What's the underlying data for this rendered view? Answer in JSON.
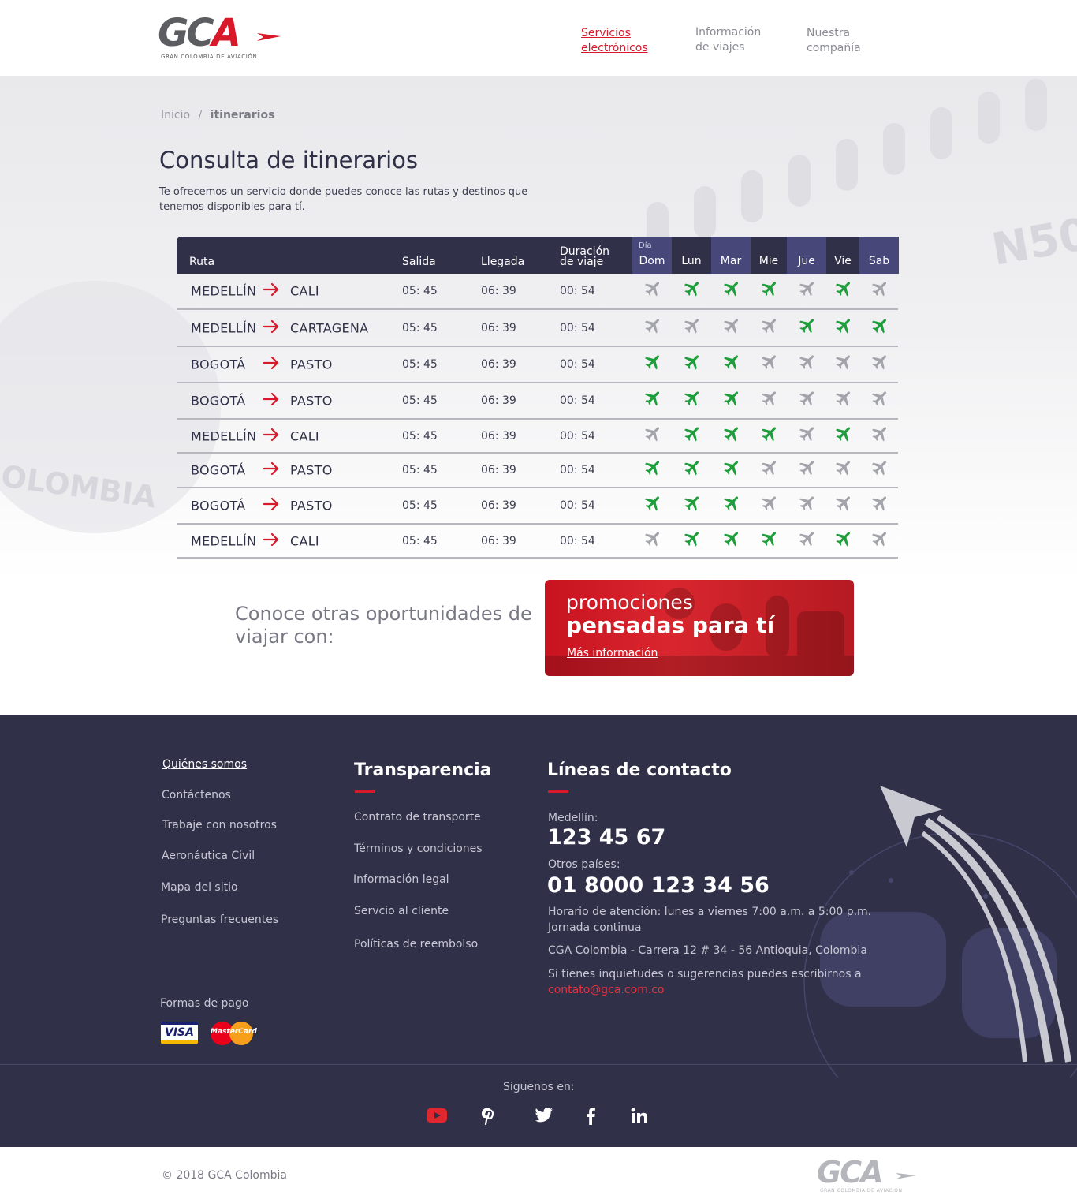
{
  "brand": {
    "logo_letters": "GCA",
    "logo_tagline": "GRAN COLOMBIA DE AVIACIÓN"
  },
  "nav": {
    "items": [
      {
        "line1": "Servicios",
        "line2": "electrónicos",
        "active": true
      },
      {
        "line1": "Información",
        "line2": "de viajes",
        "active": false
      },
      {
        "line1": "Nuestra",
        "line2": "compañía",
        "active": false
      }
    ]
  },
  "breadcrumb": {
    "home": "Inicio",
    "separator": "/",
    "current": "itinerarios"
  },
  "page": {
    "title": "Consulta de itinerarios",
    "intro": "Te ofrecemos un servicio donde puedes conoce las rutas y destinos que tenemos disponibles para tí."
  },
  "table": {
    "headers": {
      "route": "Ruta",
      "departure": "Salida",
      "arrival": "Llegada",
      "duration_line1": "Duración",
      "duration_line2": "de viaje",
      "day_label": "Día"
    },
    "days": [
      "Dom",
      "Lun",
      "Mar",
      "Mie",
      "Jue",
      "Vie",
      "Sab"
    ],
    "rows": [
      {
        "from": "MEDELLÍN",
        "to": "CALI",
        "departure": "05: 45",
        "arrival": "06: 39",
        "duration": "00: 54",
        "days": [
          false,
          true,
          true,
          true,
          false,
          true,
          false
        ]
      },
      {
        "from": "MEDELLÍN",
        "to": "CARTAGENA",
        "departure": "05: 45",
        "arrival": "06: 39",
        "duration": "00: 54",
        "days": [
          false,
          false,
          false,
          false,
          true,
          true,
          true
        ]
      },
      {
        "from": "BOGOTÁ",
        "to": "PASTO",
        "departure": "05: 45",
        "arrival": "06: 39",
        "duration": "00: 54",
        "days": [
          true,
          true,
          true,
          false,
          false,
          false,
          false
        ]
      },
      {
        "from": "BOGOTÁ",
        "to": "PASTO",
        "departure": "05: 45",
        "arrival": "06: 39",
        "duration": "00: 54",
        "days": [
          true,
          true,
          true,
          false,
          false,
          false,
          false
        ]
      },
      {
        "from": "MEDELLÍN",
        "to": "CALI",
        "departure": "05: 45",
        "arrival": "06: 39",
        "duration": "00: 54",
        "days": [
          false,
          true,
          true,
          true,
          false,
          true,
          false
        ]
      },
      {
        "from": "BOGOTÁ",
        "to": "PASTO",
        "departure": "05: 45",
        "arrival": "06: 39",
        "duration": "00: 54",
        "days": [
          true,
          true,
          true,
          false,
          false,
          false,
          false
        ]
      },
      {
        "from": "BOGOTÁ",
        "to": "PASTO",
        "departure": "05: 45",
        "arrival": "06: 39",
        "duration": "00: 54",
        "days": [
          true,
          true,
          true,
          false,
          false,
          false,
          false
        ]
      },
      {
        "from": "MEDELLÍN",
        "to": "CALI",
        "departure": "05: 45",
        "arrival": "06: 39",
        "duration": "00: 54",
        "days": [
          false,
          true,
          true,
          true,
          false,
          true,
          false
        ]
      }
    ]
  },
  "promo": {
    "text": "Conoce otras oportunidades de viajar con:",
    "card_line1": "promociones",
    "card_line2": "pensadas para tí",
    "card_link": "Más información"
  },
  "footer": {
    "links_col1": [
      "Quiénes somos",
      "Contáctenos",
      "Trabaje con nosotros",
      "Aeronáutica Civil",
      "Mapa del sitio",
      "Preguntas frecuentes"
    ],
    "transparency_title": "Transparencia",
    "links_col2": [
      "Contrato de transporte",
      "Términos y condiciones",
      "Información legal",
      "Servcio al cliente",
      "Políticas de reembolso"
    ],
    "contact_title": "Líneas de contacto",
    "medellin_label": "Medellín:",
    "medellin_phone": "123 45 67",
    "other_label": "Otros países:",
    "other_phone": "01 8000 123 34 56",
    "hours": "Horario de atención: lunes a viernes 7:00 a.m. a 5:00 p.m.",
    "hours2": "Jornada continua",
    "address": "CGA Colombia - Carrera 12 # 34 - 56 Antioquia, Colombia",
    "suggest": "Si tienes inquietudes o sugerencias puedes escribirnos a",
    "email": "contato@gca.com.co",
    "payments_label": "Formas de pago",
    "visa": "VISA",
    "mastercard": "MasterCard",
    "follow": "Siguenos en:",
    "social": [
      "youtube-icon",
      "pinterest-icon",
      "twitter-icon",
      "facebook-icon",
      "linkedin-icon"
    ]
  },
  "bottom": {
    "copyright": "© 2018 GCA Colombia"
  },
  "colors": {
    "brand_red": "#d7192a",
    "navy": "#303149",
    "available_green": "#1d9e3a",
    "unavailable_gray": "#a3a4ab"
  }
}
